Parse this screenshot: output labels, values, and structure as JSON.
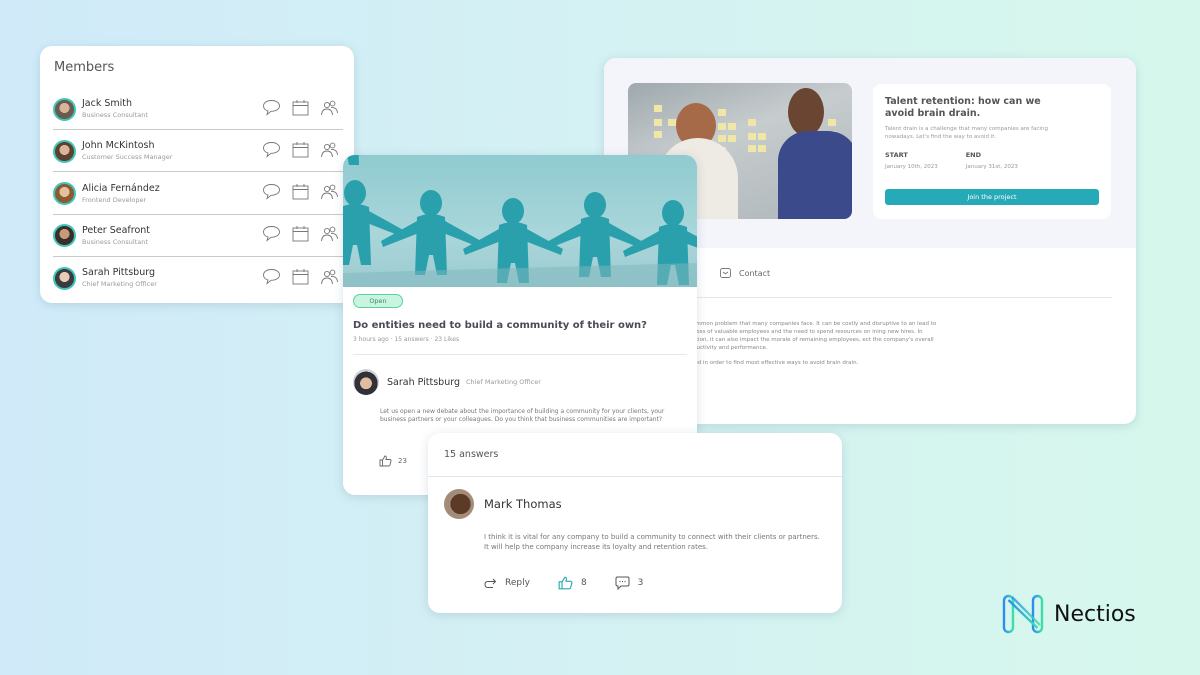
{
  "members_card": {
    "title": "Members",
    "members": [
      {
        "name": "Jack Smith",
        "role": "Business Consultant"
      },
      {
        "name": "John McKintosh",
        "role": "Customer Success Manager"
      },
      {
        "name": "Alicia Fernández",
        "role": "Frontend Developer"
      },
      {
        "name": "Peter Seafront",
        "role": "Business Consultant"
      },
      {
        "name": "Sarah Pittsburg",
        "role": "Chief Marketing Officer"
      }
    ],
    "row_icons": [
      "chat-bubble-icon",
      "calendar-icon",
      "group-icon"
    ]
  },
  "project_card": {
    "title": "Talent retention: how can we avoid brain drain.",
    "description": "Talent drain is a challenge that many companies are facing nowadays. Let's find the way to avoid it.",
    "start_label": "START",
    "start_date": "January 10th, 2023",
    "end_label": "END",
    "end_date": "January 31st, 2023",
    "join_button": "Join the project",
    "contact_tab": "Contact",
    "body_paragraphs": [
      "a common problem that many companies face. It can be costly and disruptive to an lead to the loss of valuable employees and the need to spend resources on ining new hires. In addition, it can also impact the morale of remaining employees, ect the company's overall productivity and performance.",
      "pened in order to find most effective ways to avoid brain drain."
    ]
  },
  "post_card": {
    "badge": "Open",
    "title": "Do entities need to build a community of their own?",
    "meta": "3 hours ago · 15 answers · 23 Likes",
    "author_name": "Sarah Pittsburg",
    "author_role": "Chief Marketing Officer",
    "body": "Let us open a new debate about the importance of building a community for your clients, your business partners or your colleagues. Do you think that business communities are important?",
    "likes": "23"
  },
  "answers_card": {
    "header": "15 answers",
    "author_name": "Mark Thomas",
    "body": "I think it is vital for any company to build a community to connect with their clients or partners. It will help the company increase its loyalty and retention rates.",
    "reply_label": "Reply",
    "likes": "8",
    "comments": "3"
  },
  "brand": {
    "name": "Nectios",
    "accent": "#27aab7",
    "gradient_start": "#2b8df0",
    "gradient_end": "#3fe0a8"
  }
}
